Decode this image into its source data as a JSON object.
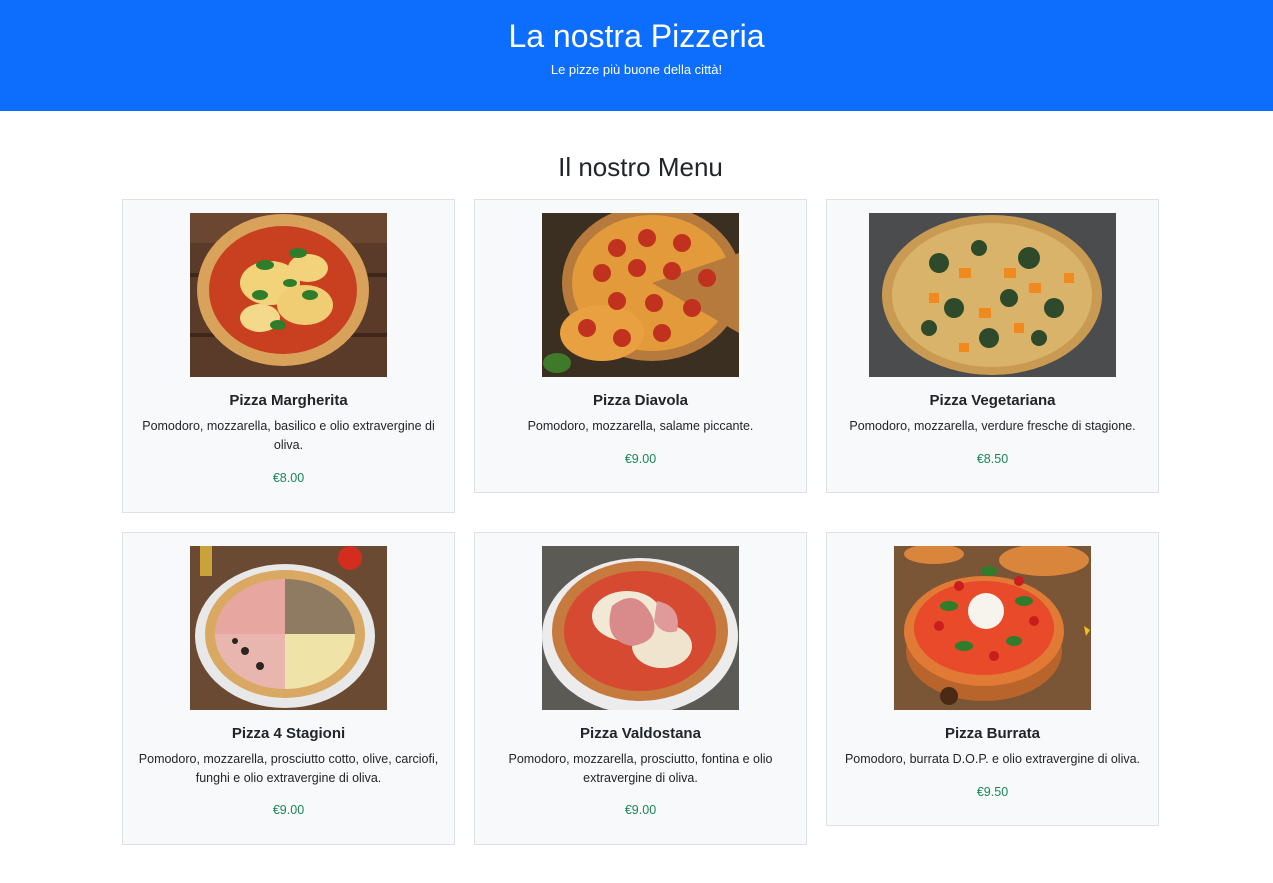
{
  "header": {
    "title": "La nostra Pizzeria",
    "subtitle": "Le pizze più buone della città!"
  },
  "menu": {
    "title": "Il nostro Menu",
    "items": [
      {
        "name": "Pizza Margherita",
        "description": "Pomodoro, mozzarella, basilico e olio extravergine di oliva.",
        "price": "€8.00"
      },
      {
        "name": "Pizza Diavola",
        "description": "Pomodoro, mozzarella, salame piccante.",
        "price": "€9.00"
      },
      {
        "name": "Pizza Vegetariana",
        "description": "Pomodoro, mozzarella, verdure fresche di stagione.",
        "price": "€8.50"
      },
      {
        "name": "Pizza 4 Stagioni",
        "description": "Pomodoro, mozzarella, prosciutto cotto, olive, carciofi, funghi e olio extravergine di oliva.",
        "price": "€9.00"
      },
      {
        "name": "Pizza Valdostana",
        "description": "Pomodoro, mozzarella, prosciutto, fontina e olio extravergine di oliva.",
        "price": "€9.00"
      },
      {
        "name": "Pizza Burrata",
        "description": "Pomodoro, burrata D.O.P. e olio extravergine di oliva.",
        "price": "€9.50"
      }
    ]
  },
  "colors": {
    "header_bg": "#0d6efd",
    "card_bg": "#f8f9fa",
    "card_border": "#dee2e6",
    "price": "#198754"
  }
}
